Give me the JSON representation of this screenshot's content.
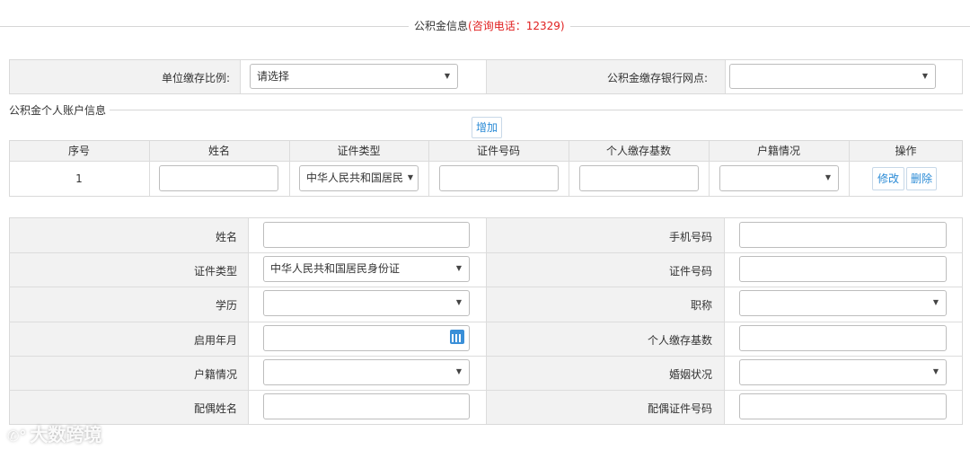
{
  "header": {
    "title": "公积金信息",
    "hotline": "(咨询电话：12329)"
  },
  "unit_section": {
    "ratio_label": "单位缴存比例:",
    "ratio_value": "请选择",
    "bank_label": "公积金缴存银行网点:",
    "bank_value": ""
  },
  "account_section": {
    "title": "公积金个人账户信息",
    "add_button": "增加",
    "columns": [
      "序号",
      "姓名",
      "证件类型",
      "证件号码",
      "个人缴存基数",
      "户籍情况",
      "操作"
    ],
    "row": {
      "index": "1",
      "name": "",
      "id_type": "中华人民共和国居民",
      "id_number": "",
      "base": "",
      "household": "",
      "edit": "修改",
      "delete": "删除"
    }
  },
  "detail_form": {
    "name_label": "姓名",
    "name_value": "",
    "phone_label": "手机号码",
    "phone_value": "",
    "id_type_label": "证件类型",
    "id_type_value": "中华人民共和国居民身份证",
    "id_number_label": "证件号码",
    "id_number_value": "",
    "education_label": "学历",
    "education_value": "",
    "title_label": "职称",
    "title_value": "",
    "start_label": "启用年月",
    "start_value": "",
    "base_label": "个人缴存基数",
    "base_value": "",
    "household_label": "户籍情况",
    "household_value": "",
    "marital_label": "婚姻状况",
    "marital_value": "",
    "spouse_name_label": "配偶姓名",
    "spouse_name_value": "",
    "spouse_id_label": "配偶证件号码",
    "spouse_id_value": ""
  },
  "watermark": "大数跨境",
  "colors": {
    "accent": "#2b8bd6",
    "hotline": "#e02020",
    "label_bg": "#f2f2f2"
  }
}
